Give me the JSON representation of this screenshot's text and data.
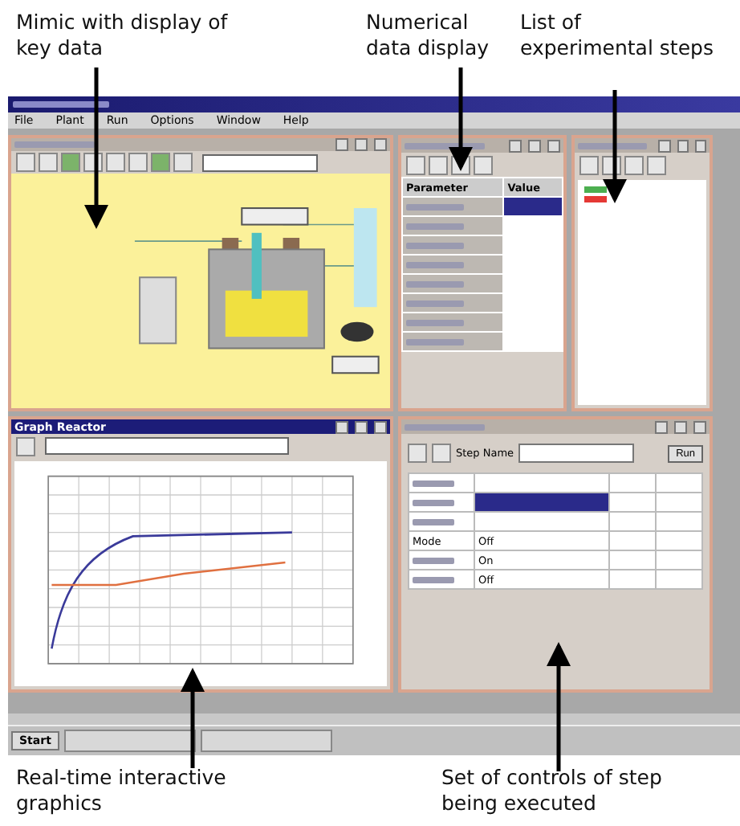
{
  "captions_top": [
    {
      "text": "Mimic with display of key data"
    },
    {
      "text": "Numerical data display"
    },
    {
      "text": "List of experimental steps"
    }
  ],
  "menu": [
    "File",
    "Plant",
    "Run",
    "Options",
    "Window",
    "Help"
  ],
  "numeric_window": {
    "columns": [
      "Parameter",
      "Value"
    ],
    "rows": [
      {
        "selected": true
      },
      {
        "selected": false
      },
      {
        "selected": false
      },
      {
        "selected": false
      },
      {
        "selected": false
      },
      {
        "selected": false
      },
      {
        "selected": false
      },
      {
        "selected": false
      }
    ]
  },
  "steps_window": {
    "items": [
      {
        "color": "#4caf50"
      },
      {
        "color": "#e53935"
      }
    ]
  },
  "graph_window": {
    "title": "Graph Reactor"
  },
  "step_window": {
    "name_label": "Step Name",
    "run_button": "Run",
    "rows": [
      {
        "value": "",
        "selected": false
      },
      {
        "value": "",
        "selected": true
      },
      {
        "value": "",
        "selected": false
      },
      {
        "label": "Mode",
        "value": "Off",
        "selected": false
      },
      {
        "value": "On",
        "selected": false
      },
      {
        "value": "Off",
        "selected": false
      }
    ]
  },
  "taskbar": {
    "start": "Start"
  },
  "captions_bottom": [
    {
      "text": "Real-time interactive graphics"
    },
    {
      "text": "Set of controls of step being executed"
    }
  ]
}
